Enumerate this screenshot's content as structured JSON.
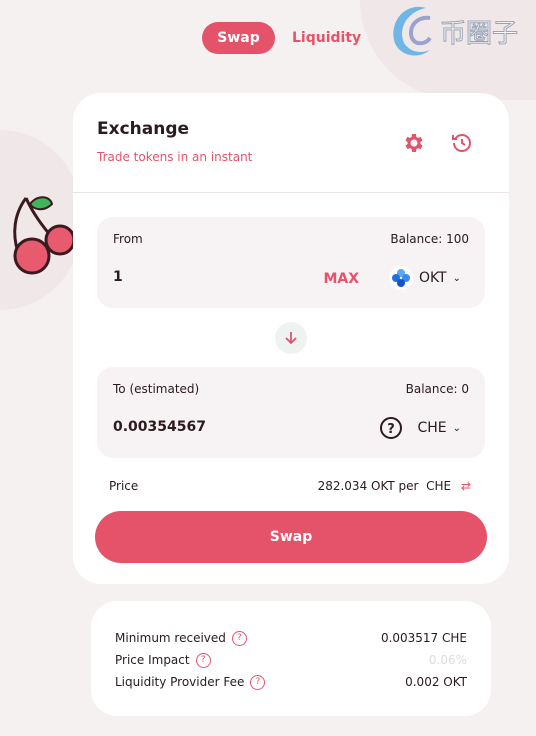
{
  "nav": {
    "tabs": [
      {
        "label": "Swap",
        "active": true
      },
      {
        "label": "Liquidity",
        "active": false
      }
    ]
  },
  "watermark": {
    "text": "币圈子"
  },
  "exchange": {
    "title": "Exchange",
    "subtitle": "Trade tokens in an instant",
    "icons": [
      "gear-icon",
      "history-icon"
    ]
  },
  "from": {
    "label": "From",
    "balance": "Balance: 100",
    "amount": "1",
    "max_label": "MAX",
    "token": "OKT"
  },
  "to": {
    "label": "To (estimated)",
    "balance": "Balance: 0",
    "amount": "0.00354567",
    "token": "CHE"
  },
  "price": {
    "label": "Price",
    "value": "282.034 OKT per",
    "unit": "CHE"
  },
  "swap_button": "Swap",
  "details": [
    {
      "label": "Minimum received",
      "value": "0.003517  CHE"
    },
    {
      "label": "Price Impact",
      "value": "0.06%"
    },
    {
      "label": "Liquidity Provider Fee",
      "value": "0.002 OKT"
    }
  ],
  "colors": {
    "accent": "#e5536b",
    "background": "#f5f1f1"
  }
}
